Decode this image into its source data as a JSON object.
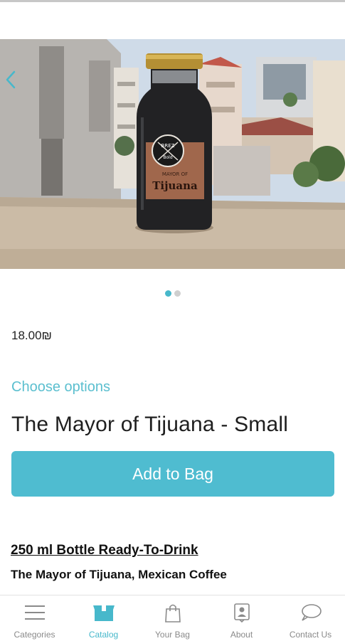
{
  "product": {
    "price": "18.00₪",
    "choose_options": "Choose options",
    "title": "The Mayor of Tijuana - Small",
    "add_to_bag": "Add to Bag",
    "description_heading": "250 ml Bottle Ready-To-Drink",
    "description_sub": "The Mayor of Tijuana, Mexican Coffee",
    "bottle_label_top": "BREZ",
    "bottle_label_bottom": "Bold",
    "bottle_label_small": "MAYOR OF",
    "bottle_label_name": "Tijuana"
  },
  "carousel": {
    "count": 2,
    "active_index": 0
  },
  "nav": {
    "items": [
      {
        "label": "Categories",
        "icon": "menu-icon"
      },
      {
        "label": "Catalog",
        "icon": "catalog-box-icon"
      },
      {
        "label": "Your Bag",
        "icon": "shopping-bag-icon"
      },
      {
        "label": "About",
        "icon": "about-person-icon"
      },
      {
        "label": "Contact Us",
        "icon": "chat-bubble-icon"
      }
    ],
    "active": "Catalog"
  },
  "colors": {
    "accent": "#4fbcd0",
    "inactive": "#8a8a8a"
  }
}
